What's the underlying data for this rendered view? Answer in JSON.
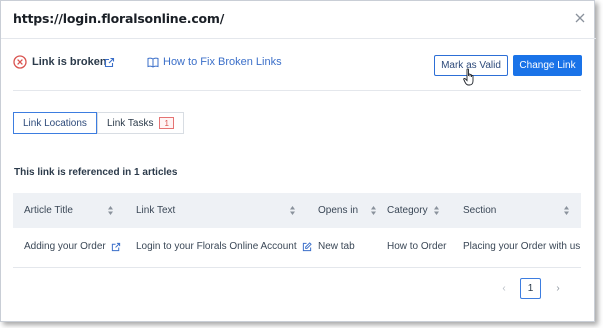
{
  "dialog": {
    "title": "https://login.floralsonline.com/",
    "status_label": "Link is broken",
    "help_link": "How to Fix Broken Links",
    "mark_valid_button": "Mark as Valid",
    "change_link_button": "Change Link"
  },
  "tabs": [
    {
      "label": "Link Locations",
      "active": true
    },
    {
      "label": "Link Tasks",
      "badge": "1"
    }
  ],
  "reference_text": "This link is referenced in 1 articles",
  "table": {
    "columns": [
      "Article Title",
      "Link Text",
      "Opens in",
      "Category",
      "Section"
    ],
    "rows": [
      {
        "article_title": "Adding your Order",
        "link_text": "Login to your Florals Online Account",
        "opens_in": "New tab",
        "category": "How to Order",
        "section": "Placing your Order with us"
      }
    ]
  },
  "pagination": {
    "prev": "‹",
    "current": "1",
    "next": "›"
  },
  "colors": {
    "primary": "#1a73e8",
    "error": "#d9534f",
    "link": "#3b6fc9"
  },
  "icons": [
    "close-icon",
    "error-circle-icon",
    "external-link-icon",
    "book-icon",
    "sort-icon",
    "edit-icon",
    "hand-cursor-icon"
  ]
}
